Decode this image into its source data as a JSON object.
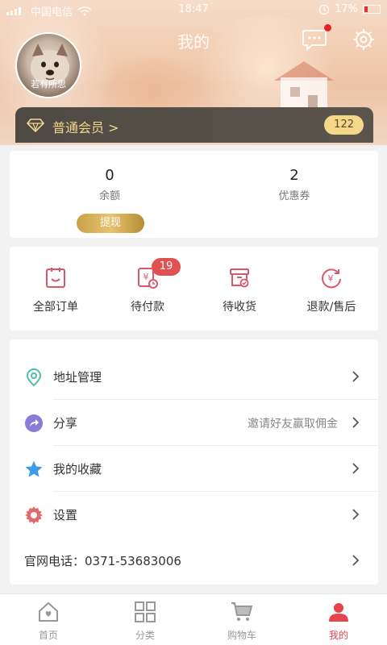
{
  "status_bar": {
    "carrier": "中国电信",
    "time": "18:47",
    "battery": "17%"
  },
  "header": {
    "title": "我的",
    "username": "若有所思",
    "member_level": "普通会员 >",
    "points": "122"
  },
  "balance_card": {
    "balance_value": "0",
    "balance_label": "余额",
    "coupon_value": "2",
    "coupon_label": "优惠券",
    "withdraw_label": "提现"
  },
  "orders": {
    "items": [
      {
        "label": "全部订单"
      },
      {
        "label": "待付款",
        "badge": "19"
      },
      {
        "label": "待收货"
      },
      {
        "label": "退款/售后"
      }
    ]
  },
  "menu": {
    "address": "地址管理",
    "share": "分享",
    "share_hint": "邀请好友赢取佣金",
    "favorites": "我的收藏",
    "settings": "设置",
    "phone": "官网电话：0371-53683006"
  },
  "bottom_nav": {
    "tabs": [
      {
        "label": "首页"
      },
      {
        "label": "分类"
      },
      {
        "label": "购物车"
      },
      {
        "label": "我的"
      }
    ]
  },
  "colors": {
    "accent": "#e5434e",
    "gold": "#f5d78a",
    "order_icon": "#d9576b",
    "badge": "#e05151"
  },
  "icons": [
    "message-icon",
    "settings-icon",
    "diamond-icon",
    "order-list-icon",
    "pending-payment-icon",
    "pending-receipt-icon",
    "refund-icon",
    "location-icon",
    "share-icon",
    "star-icon",
    "gear-icon",
    "chevron-right-icon",
    "home-icon",
    "category-icon",
    "cart-icon",
    "user-icon"
  ]
}
